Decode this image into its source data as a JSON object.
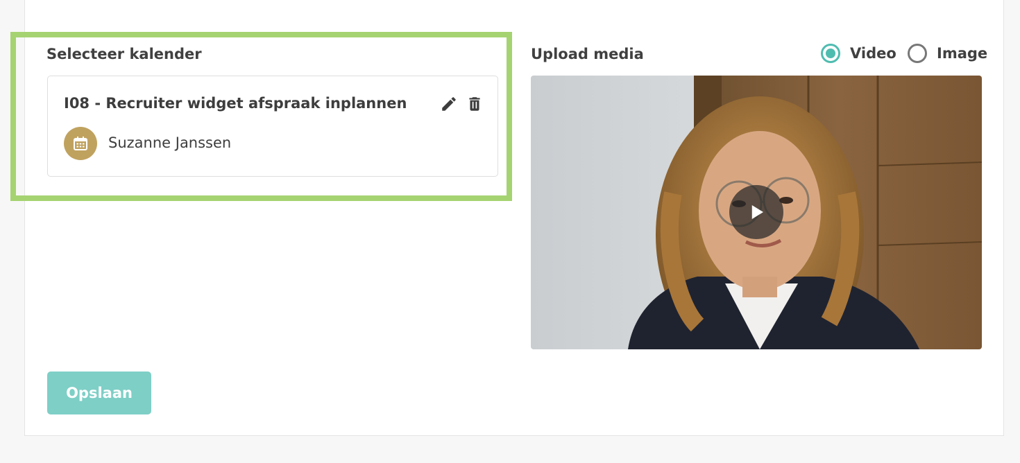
{
  "calendar_section": {
    "title": "Selecteer kalender",
    "card": {
      "name": "I08 - Recruiter widget afspraak inplannen",
      "owner": "Suzanne Janssen"
    }
  },
  "media_section": {
    "title": "Upload media",
    "options": [
      {
        "label": "Video",
        "selected": true
      },
      {
        "label": "Image",
        "selected": false
      }
    ]
  },
  "actions": {
    "save_label": "Opslaan"
  },
  "colors": {
    "highlight": "#a5d371",
    "accent": "#4fbcb0",
    "save_button": "#7ecfc6",
    "avatar": "#c0a25f"
  },
  "icons": {
    "edit": "pencil-icon",
    "delete": "trash-icon",
    "avatar": "calendar-icon",
    "play": "play-icon"
  }
}
